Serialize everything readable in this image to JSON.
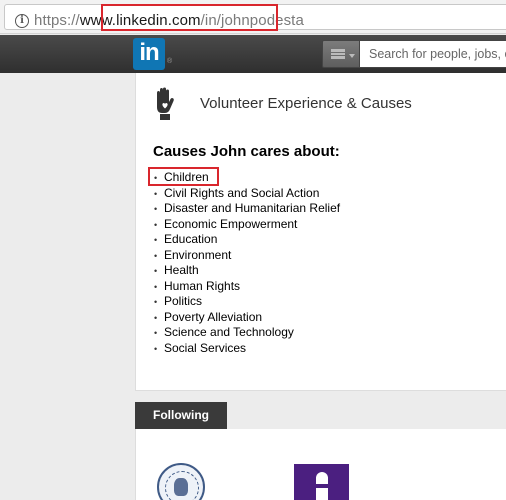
{
  "browser": {
    "url_scheme": "https://",
    "url_domain": "www.linkedin.com",
    "url_path": "/in/johnpodesta",
    "info_icon": "info-icon"
  },
  "navbar": {
    "logo_text": "in",
    "logo_reg": "®",
    "search_placeholder": "Search for people, jobs, companies, and more..."
  },
  "section": {
    "icon": "hand-heart-icon",
    "title": "Volunteer Experience & Causes",
    "causes_heading": "Causes John cares about:",
    "causes": [
      "Children",
      "Civil Rights and Social Action",
      "Disaster and Humanitarian Relief",
      "Economic Empowerment",
      "Education",
      "Environment",
      "Health",
      "Human Rights",
      "Politics",
      "Poverty Alleviation",
      "Science and Technology",
      "Social Services"
    ]
  },
  "following": {
    "tab_label": "Following"
  },
  "colors": {
    "linkedin_blue": "#1076b4",
    "highlight_red": "#d9262d",
    "navbar_dark": "#3a3a3a",
    "university_purple": "#4b1f80"
  }
}
